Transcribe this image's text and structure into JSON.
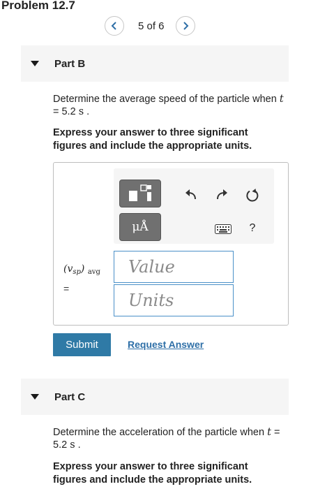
{
  "problem": {
    "title": "Problem 12.7"
  },
  "pager": {
    "text": "5 of 6",
    "prev_icon": "chevron-left-icon",
    "next_icon": "chevron-right-icon"
  },
  "partB": {
    "label": "Part B",
    "question_pre": "Determine the average speed of the particle when ",
    "question_var": "t",
    "question_mid": " = 5.2 ",
    "question_unit": "s",
    "question_end": " .",
    "instruction": "Express your answer to three significant figures and include the appropriate units.",
    "toolbar": {
      "template_icon": "fraction-template-icon",
      "units_label": "μÅ",
      "undo_icon": "undo-icon",
      "redo_icon": "redo-icon",
      "reset_icon": "reset-icon",
      "keyboard_icon": "keyboard-icon",
      "help_label": "?"
    },
    "answer_var_main": "(v",
    "answer_var_sub": "sp",
    "answer_var_close": ")",
    "answer_var_avg": "avg",
    "equals": "=",
    "value_placeholder": "Value",
    "units_placeholder": "Units",
    "submit_label": "Submit",
    "request_answer_label": "Request Answer"
  },
  "partC": {
    "label": "Part C",
    "question_pre": "Determine the acceleration of the particle when ",
    "question_var": "t",
    "question_mid": " = 5.2 ",
    "question_unit": "s",
    "question_end": " .",
    "instruction": "Express your answer to three significant figures and include the appropriate units."
  },
  "colors": {
    "accent": "#2f7aa6",
    "link": "#2e6fa7",
    "field_border": "#4a90c8",
    "tool_button": "#707070"
  }
}
